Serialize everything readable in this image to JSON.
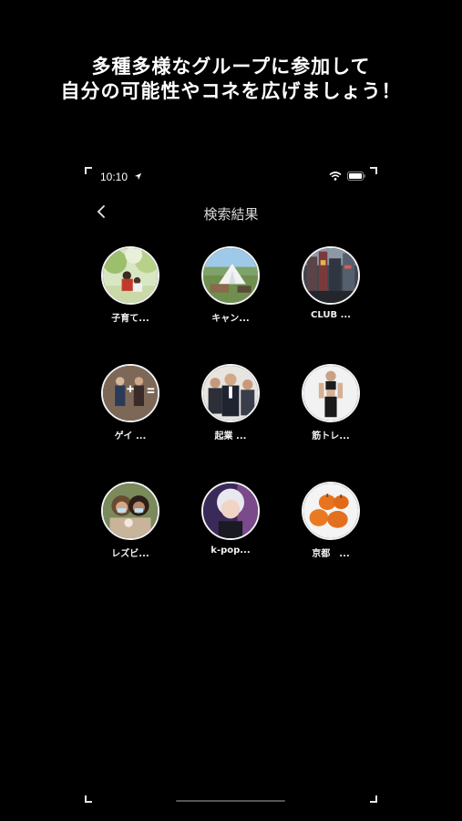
{
  "headline": {
    "line1": "多種多様なグループに参加して",
    "line2": "自分の可能性やコネを広げましょう！"
  },
  "status_bar": {
    "time": "10:10"
  },
  "nav": {
    "title": "検索結果"
  },
  "groups": [
    {
      "label": "子育て..."
    },
    {
      "label": "キャン..."
    },
    {
      "label": "CLUB ..."
    },
    {
      "label": "ゲイ ..."
    },
    {
      "label": "起業 ..."
    },
    {
      "label": "筋トレ..."
    },
    {
      "label": "レズビ..."
    },
    {
      "label": "k-pop..."
    },
    {
      "label": "京都　..."
    }
  ]
}
